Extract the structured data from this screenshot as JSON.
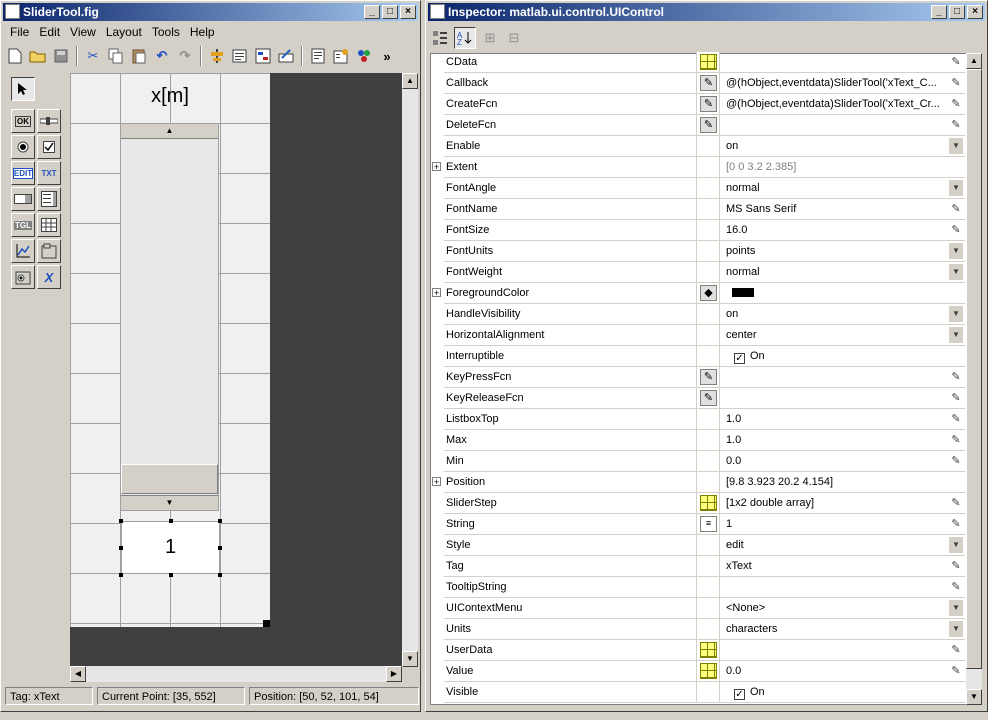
{
  "guide": {
    "title": "SliderTool.fig",
    "menu": [
      "File",
      "Edit",
      "View",
      "Layout",
      "Tools",
      "Help"
    ],
    "more_label": "»",
    "figure": {
      "axis_label": "x[m]",
      "edit_value": "1"
    },
    "status": {
      "tag": "Tag: xText",
      "current_point": "Current Point:  [35, 552]",
      "position": "Position: [50, 52, 101, 54]"
    }
  },
  "inspector": {
    "title": "Inspector:  matlab.ui.control.UIControl",
    "properties": [
      {
        "name": "CData",
        "btn": "grid",
        "value": "",
        "end": "pen"
      },
      {
        "name": "Callback",
        "btn": "pen",
        "value": "@(hObject,eventdata)SliderTool('xText_C...",
        "end": "pen"
      },
      {
        "name": "CreateFcn",
        "btn": "pen",
        "value": "@(hObject,eventdata)SliderTool('xText_Cr...",
        "end": "pen"
      },
      {
        "name": "DeleteFcn",
        "btn": "pen",
        "value": "",
        "end": "pen"
      },
      {
        "name": "Enable",
        "btn": "",
        "value": "on",
        "end": "drop"
      },
      {
        "name": "Extent",
        "btn": "",
        "value": "[0 0 3.2 2.385]",
        "end": "",
        "expand": true,
        "gray": true
      },
      {
        "name": "FontAngle",
        "btn": "",
        "value": "normal",
        "end": "drop"
      },
      {
        "name": "FontName",
        "btn": "",
        "value": "MS Sans Serif",
        "end": "pen"
      },
      {
        "name": "FontSize",
        "btn": "",
        "value": "16.0",
        "end": "pen"
      },
      {
        "name": "FontUnits",
        "btn": "",
        "value": "points",
        "end": "drop"
      },
      {
        "name": "FontWeight",
        "btn": "",
        "value": "normal",
        "end": "drop"
      },
      {
        "name": "ForegroundColor",
        "btn": "bucket",
        "value": "",
        "end": "",
        "expand": true,
        "swatch": "#000000"
      },
      {
        "name": "HandleVisibility",
        "btn": "",
        "value": "on",
        "end": "drop"
      },
      {
        "name": "HorizontalAlignment",
        "btn": "",
        "value": "center",
        "end": "drop"
      },
      {
        "name": "Interruptible",
        "btn": "",
        "value": "On",
        "end": "",
        "check": true
      },
      {
        "name": "KeyPressFcn",
        "btn": "pen",
        "value": "",
        "end": "pen"
      },
      {
        "name": "KeyReleaseFcn",
        "btn": "pen",
        "value": "",
        "end": "pen"
      },
      {
        "name": "ListboxTop",
        "btn": "",
        "value": "1.0",
        "end": "pen"
      },
      {
        "name": "Max",
        "btn": "",
        "value": "1.0",
        "end": "pen"
      },
      {
        "name": "Min",
        "btn": "",
        "value": "0.0",
        "end": "pen"
      },
      {
        "name": "Position",
        "btn": "",
        "value": "[9.8 3.923 20.2 4.154]",
        "end": "",
        "expand": true
      },
      {
        "name": "SliderStep",
        "btn": "grid",
        "value": "[1x2  double array]",
        "end": "pen"
      },
      {
        "name": "String",
        "btn": "text",
        "value": "1",
        "end": "pen"
      },
      {
        "name": "Style",
        "btn": "",
        "value": "edit",
        "end": "drop"
      },
      {
        "name": "Tag",
        "btn": "",
        "value": "xText",
        "end": "pen"
      },
      {
        "name": "TooltipString",
        "btn": "",
        "value": "",
        "end": "pen"
      },
      {
        "name": "UIContextMenu",
        "btn": "",
        "value": "<None>",
        "end": "drop"
      },
      {
        "name": "Units",
        "btn": "",
        "value": "characters",
        "end": "drop"
      },
      {
        "name": "UserData",
        "btn": "grid",
        "value": "",
        "end": "pen"
      },
      {
        "name": "Value",
        "btn": "grid",
        "value": "0.0",
        "end": "pen"
      },
      {
        "name": "Visible",
        "btn": "",
        "value": "On",
        "end": "",
        "check": true
      }
    ]
  },
  "colors": {
    "title_start": "#0a246a",
    "title_end": "#a6caf0",
    "canvas": "#404040"
  }
}
